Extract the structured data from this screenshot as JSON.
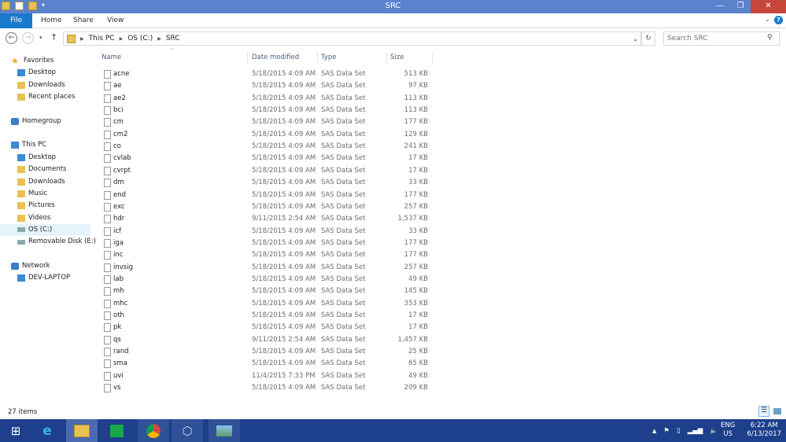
{
  "window": {
    "title": "SRC",
    "controls": [
      "—",
      "❐",
      "✕"
    ]
  },
  "ribbon": {
    "tabs": [
      "File",
      "Home",
      "Share",
      "View"
    ],
    "help": "?"
  },
  "address": {
    "crumbs": [
      "This PC",
      "OS (C:)",
      "SRC"
    ],
    "search_placeholder": "Search SRC"
  },
  "sidebar": [
    {
      "label": "Favorites",
      "icon": "star-icon",
      "indent": 0,
      "y": 0
    },
    {
      "label": "Desktop",
      "icon": "desktop-icon",
      "indent": 1,
      "y": 1
    },
    {
      "label": "Downloads",
      "icon": "downloads-icon",
      "indent": 1,
      "y": 2
    },
    {
      "label": "Recent places",
      "icon": "recent-icon",
      "indent": 1,
      "y": 3
    },
    {
      "label": "Homegroup",
      "icon": "homegroup-icon",
      "indent": 0,
      "y": 5
    },
    {
      "label": "This PC",
      "icon": "pc-icon",
      "indent": 0,
      "y": 7
    },
    {
      "label": "Desktop",
      "icon": "desktop-icon",
      "indent": 1,
      "y": 8
    },
    {
      "label": "Documents",
      "icon": "documents-icon",
      "indent": 1,
      "y": 9
    },
    {
      "label": "Downloads",
      "icon": "downloads-icon",
      "indent": 1,
      "y": 10
    },
    {
      "label": "Music",
      "icon": "music-icon",
      "indent": 1,
      "y": 11
    },
    {
      "label": "Pictures",
      "icon": "pictures-icon",
      "indent": 1,
      "y": 12
    },
    {
      "label": "Videos",
      "icon": "videos-icon",
      "indent": 1,
      "y": 13
    },
    {
      "label": "OS (C:)",
      "icon": "drive-icon",
      "indent": 1,
      "y": 14,
      "selected": true
    },
    {
      "label": "Removable Disk (E:)",
      "icon": "removable-drive-icon",
      "indent": 1,
      "y": 15
    },
    {
      "label": "Network",
      "icon": "network-icon",
      "indent": 0,
      "y": 17
    },
    {
      "label": "DEV-LAPTOP",
      "icon": "computer-icon",
      "indent": 1,
      "y": 18
    }
  ],
  "columns": [
    "Name",
    "Date modified",
    "Type",
    "Size"
  ],
  "files": [
    [
      "acne",
      "5/18/2015 4:09 AM",
      "SAS Data Set",
      "513 KB"
    ],
    [
      "ae",
      "5/18/2015 4:09 AM",
      "SAS Data Set",
      "97 KB"
    ],
    [
      "ae2",
      "5/18/2015 4:09 AM",
      "SAS Data Set",
      "113 KB"
    ],
    [
      "bci",
      "5/18/2015 4:09 AM",
      "SAS Data Set",
      "113 KB"
    ],
    [
      "cm",
      "5/18/2015 4:09 AM",
      "SAS Data Set",
      "177 KB"
    ],
    [
      "cm2",
      "5/18/2015 4:09 AM",
      "SAS Data Set",
      "129 KB"
    ],
    [
      "co",
      "5/18/2015 4:09 AM",
      "SAS Data Set",
      "241 KB"
    ],
    [
      "cvlab",
      "5/18/2015 4:09 AM",
      "SAS Data Set",
      "17 KB"
    ],
    [
      "cvrpt",
      "5/18/2015 4:09 AM",
      "SAS Data Set",
      "17 KB"
    ],
    [
      "dm",
      "5/18/2015 4:09 AM",
      "SAS Data Set",
      "33 KB"
    ],
    [
      "end",
      "5/18/2015 4:09 AM",
      "SAS Data Set",
      "177 KB"
    ],
    [
      "exc",
      "5/18/2015 4:09 AM",
      "SAS Data Set",
      "257 KB"
    ],
    [
      "hdr",
      "9/11/2015 2:54 AM",
      "SAS Data Set",
      "1,537 KB"
    ],
    [
      "icf",
      "5/18/2015 4:09 AM",
      "SAS Data Set",
      "33 KB"
    ],
    [
      "iga",
      "5/18/2015 4:09 AM",
      "SAS Data Set",
      "177 KB"
    ],
    [
      "inc",
      "5/18/2015 4:09 AM",
      "SAS Data Set",
      "177 KB"
    ],
    [
      "invsig",
      "5/18/2015 4:09 AM",
      "SAS Data Set",
      "257 KB"
    ],
    [
      "lab",
      "5/18/2015 4:09 AM",
      "SAS Data Set",
      "49 KB"
    ],
    [
      "mh",
      "5/18/2015 4:09 AM",
      "SAS Data Set",
      "145 KB"
    ],
    [
      "mhc",
      "5/18/2015 4:09 AM",
      "SAS Data Set",
      "353 KB"
    ],
    [
      "oth",
      "5/18/2015 4:09 AM",
      "SAS Data Set",
      "17 KB"
    ],
    [
      "pk",
      "5/18/2015 4:09 AM",
      "SAS Data Set",
      "17 KB"
    ],
    [
      "qs",
      "9/11/2015 2:54 AM",
      "SAS Data Set",
      "1,457 KB"
    ],
    [
      "rand",
      "5/18/2015 4:09 AM",
      "SAS Data Set",
      "25 KB"
    ],
    [
      "sma",
      "5/18/2015 4:09 AM",
      "SAS Data Set",
      "65 KB"
    ],
    [
      "uvi",
      "11/4/2015 7:33 PM",
      "SAS Data Set",
      "49 KB"
    ],
    [
      "vs",
      "5/18/2015 4:09 AM",
      "SAS Data Set",
      "209 KB"
    ]
  ],
  "status": {
    "items": "27 items"
  },
  "taskbar": {
    "lang1": "ENG",
    "lang2": "US",
    "time": "6:22 AM",
    "date": "6/13/2017"
  }
}
